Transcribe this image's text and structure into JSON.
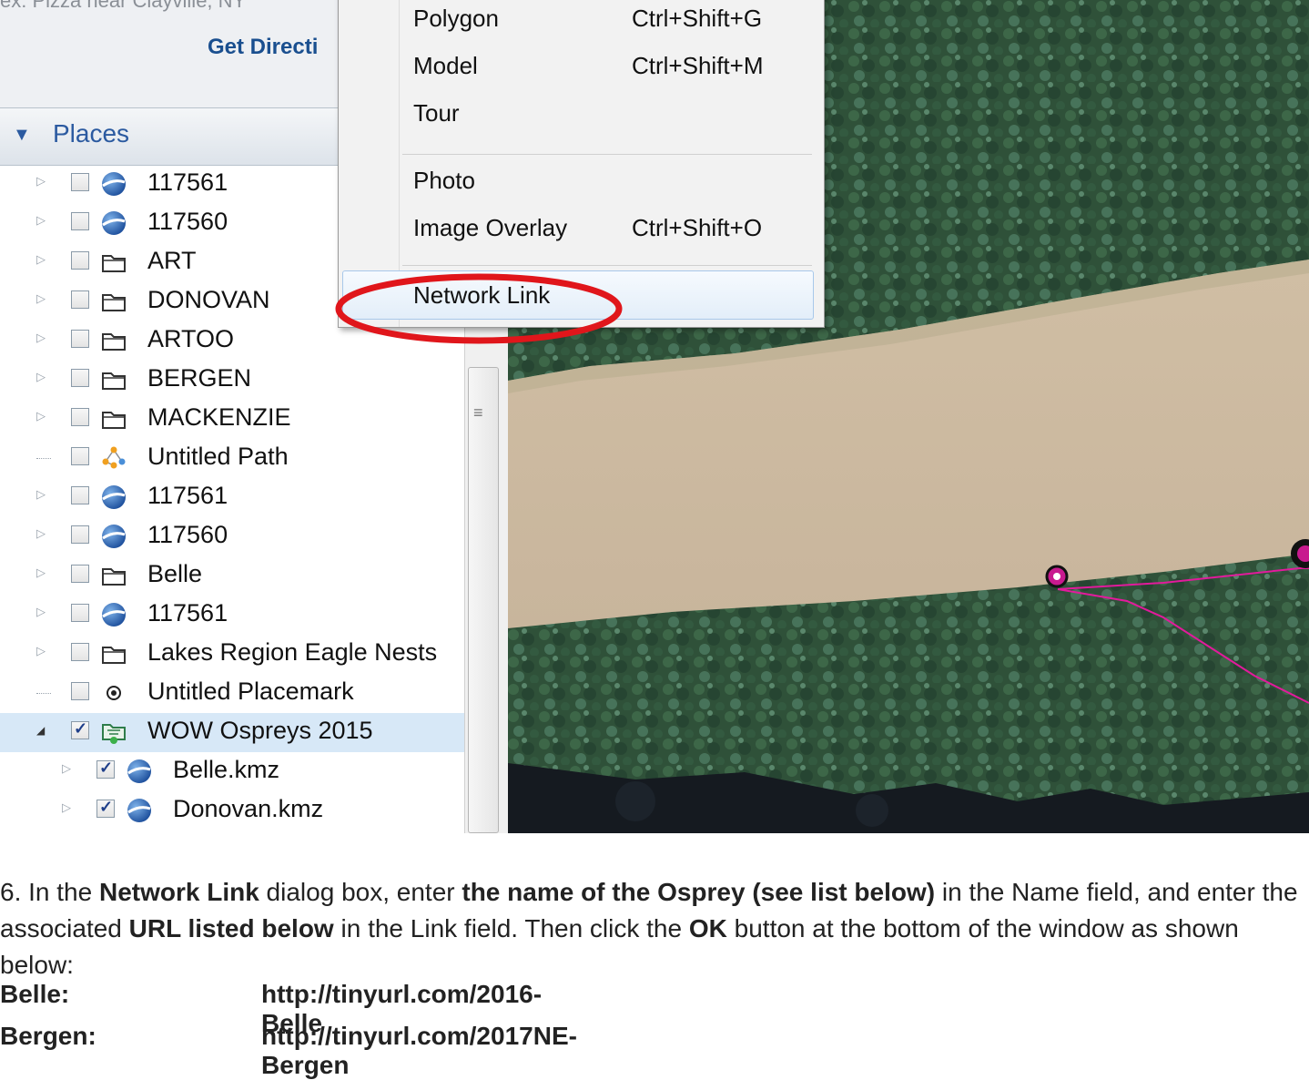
{
  "search": {
    "hint": "ex: Pizza near Clayville, NY",
    "get_directions": "Get Directi"
  },
  "places": {
    "title": "Places",
    "items": [
      {
        "label": "117561",
        "icon": "globe-icon",
        "checked": false,
        "expand": "collapsed"
      },
      {
        "label": "117560",
        "icon": "globe-icon",
        "checked": false,
        "expand": "collapsed"
      },
      {
        "label": "ART",
        "icon": "folder-icon",
        "checked": false,
        "expand": "collapsed"
      },
      {
        "label": "DONOVAN",
        "icon": "folder-icon",
        "checked": false,
        "expand": "collapsed"
      },
      {
        "label": "ARTOO",
        "icon": "folder-icon",
        "checked": false,
        "expand": "collapsed"
      },
      {
        "label": "BERGEN",
        "icon": "folder-icon",
        "checked": false,
        "expand": "collapsed"
      },
      {
        "label": "MACKENZIE",
        "icon": "folder-icon",
        "checked": false,
        "expand": "collapsed"
      },
      {
        "label": "Untitled Path",
        "icon": "path-icon",
        "checked": false,
        "expand": "none"
      },
      {
        "label": "117561",
        "icon": "globe-icon",
        "checked": false,
        "expand": "collapsed"
      },
      {
        "label": "117560",
        "icon": "globe-icon",
        "checked": false,
        "expand": "collapsed"
      },
      {
        "label": "Belle",
        "icon": "folder-icon",
        "checked": false,
        "expand": "collapsed"
      },
      {
        "label": "117561",
        "icon": "globe-icon",
        "checked": false,
        "expand": "collapsed"
      },
      {
        "label": "Lakes Region Eagle Nests",
        "icon": "folder-icon",
        "checked": false,
        "expand": "collapsed"
      },
      {
        "label": "Untitled Placemark",
        "icon": "placemark-icon",
        "checked": false,
        "expand": "none"
      },
      {
        "label": "WOW Ospreys 2015",
        "icon": "network-link-icon",
        "checked": true,
        "expand": "expanded",
        "selected": true
      },
      {
        "label": "Belle.kmz",
        "icon": "globe-icon",
        "checked": true,
        "expand": "collapsed",
        "child": true
      },
      {
        "label": "Donovan.kmz",
        "icon": "globe-icon",
        "checked": true,
        "expand": "collapsed",
        "child": true
      }
    ]
  },
  "menu": {
    "items": [
      {
        "label": "Polygon",
        "shortcut": "Ctrl+Shift+G"
      },
      {
        "label": "Model",
        "shortcut": "Ctrl+Shift+M"
      },
      {
        "label": "Tour",
        "shortcut": ""
      },
      {
        "label": "Photo",
        "shortcut": ""
      },
      {
        "label": "Image Overlay",
        "shortcut": "Ctrl+Shift+O"
      },
      {
        "label": "Network Link",
        "shortcut": ""
      }
    ],
    "highlighted": "Network Link"
  },
  "colors": {
    "accent_blue": "#2b5aa0",
    "highlight_ring": "#e0161b",
    "track_magenta": "#e21a9c"
  },
  "instructions": {
    "step_intro": "6. In the ",
    "step_b1": "Network Link",
    "step_t2": " dialog box, enter ",
    "step_b2": "the name of the Osprey (see list below)",
    "step_t3": " in the Name field, and enter the associated ",
    "step_b3": "URL listed below",
    "step_t4": " in the Link field. Then click the ",
    "step_b4": "OK",
    "step_t5": " button at the bottom of the window as shown below:",
    "urls": [
      {
        "name": "Belle:",
        "url": "http://tinyurl.com/2016-Belle"
      },
      {
        "name": "Bergen:",
        "url": "http://tinyurl.com/2017NE-Bergen"
      }
    ]
  }
}
